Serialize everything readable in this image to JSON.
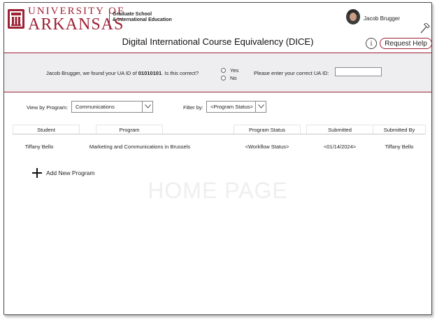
{
  "header": {
    "university_line1": "UNIVERSITY OF",
    "university_line2": "ARKANSAS",
    "school_line1": "Graduate School",
    "school_line2": "& International Education",
    "user_name": "Jacob Brugger",
    "app_title": "Digital International Course Equivalency (DICE)",
    "info_glyph": "i",
    "help_label": "Request Help",
    "brand_color": "#9d2235"
  },
  "confirm": {
    "prefix": "Jacob Brugger, we found your UA ID of ",
    "ua_id": "01010101",
    "suffix": ". Is this correct?",
    "yes_label": "Yes",
    "no_label": "No",
    "correct_label": "Please enter your correct UA ID:",
    "correct_value": ""
  },
  "filters": {
    "view_label": "View by Program:",
    "view_value": "Communications",
    "filter_label": "Filter by:",
    "filter_value": "<Program Status>"
  },
  "table": {
    "columns": [
      "Student",
      "Program",
      "Program Status",
      "Submitted",
      "Submitted By"
    ],
    "rows": [
      [
        "Tiffany Bello",
        "Marketing and Communications in Brussels",
        "<Workflow Status>",
        "<01/14/2024>",
        "Tiffany Bello"
      ]
    ]
  },
  "actions": {
    "add_label": "Add New Program"
  },
  "watermark": "HOME PAGE"
}
